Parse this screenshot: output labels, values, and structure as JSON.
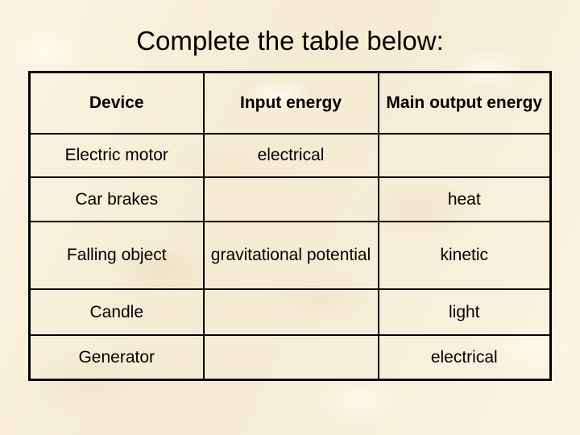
{
  "slide": {
    "title": "Complete the table below:",
    "background_color": "#f6ecd4"
  },
  "table": {
    "headers": [
      {
        "label": "Device",
        "color": "#000000"
      },
      {
        "label": "Input energy",
        "color": "#333399"
      },
      {
        "label": "Main output energy",
        "color": "#1a6b1a"
      }
    ],
    "rows": [
      {
        "device": "Electric motor",
        "device_bold": false,
        "input": "electrical",
        "output": ""
      },
      {
        "device": "Car brakes",
        "device_bold": false,
        "input": "",
        "output": "heat"
      },
      {
        "device": "Falling object",
        "device_bold": true,
        "input": "gravitational potential",
        "output": "kinetic"
      },
      {
        "device": "Candle",
        "device_bold": false,
        "input": "",
        "output": "light"
      },
      {
        "device": "Generator",
        "device_bold": false,
        "input": "",
        "output": "electrical"
      }
    ]
  }
}
